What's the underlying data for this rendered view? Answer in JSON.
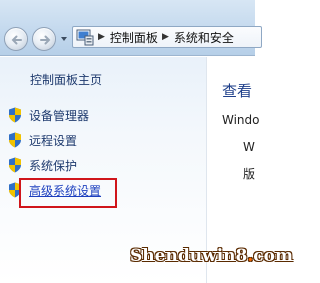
{
  "breadcrumb": {
    "separator": "▶",
    "items": [
      "控制面板",
      "系统和安全"
    ]
  },
  "sidebar": {
    "home_label": "控制面板主页",
    "tasks": [
      {
        "label": "设备管理器",
        "icon": "uac-shield-icon"
      },
      {
        "label": "远程设置",
        "icon": "uac-shield-icon"
      },
      {
        "label": "系统保护",
        "icon": "uac-shield-icon"
      },
      {
        "label": "高级系统设置",
        "icon": "uac-shield-icon",
        "highlighted": true
      }
    ]
  },
  "main": {
    "heading": "查看",
    "lines": [
      "Windo",
      "W",
      "版"
    ]
  },
  "watermark": {
    "text_start": "Shenduwin8",
    "dot": ".",
    "text_end": "com"
  },
  "colors": {
    "link": "#1e3a6e",
    "highlight_border": "#d0151b",
    "heading": "#1e3f8a"
  }
}
